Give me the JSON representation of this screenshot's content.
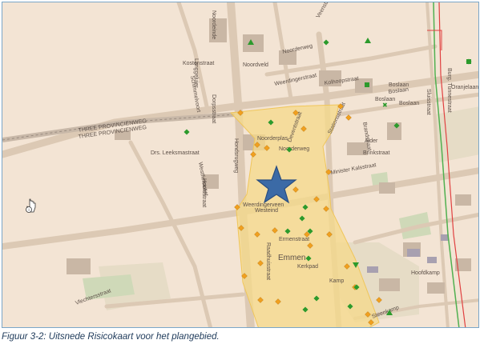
{
  "caption": "Figuur 3-2: Uitsnede Risicokaart voor het plangebied.",
  "map": {
    "colors": {
      "background": "#f3e4d4",
      "road": "#dcc9b4",
      "building": "#c9b7a5",
      "risk_zone": "#f5d98a",
      "hazard_orange": "#f0a020",
      "hazard_green": "#2c9a2c",
      "marker_star": "#3b6aa6",
      "railway": "#8a8a8a",
      "border_red": "#e04040",
      "border_green": "#50b050"
    },
    "street_labels": [
      "Noordeinde",
      "Langgeluier",
      "Noordveld",
      "Noorderweg",
      "Veenstraat",
      "Weerdingerstraat",
      "Kolhoopstraat",
      "Boslaan",
      "Boslaan",
      "Hondsrugweg",
      "Noorderplas",
      "Deventstraat",
      "Stationsstraat",
      "Minister Kalsstraat",
      "Weerdingerveen",
      "Westeind",
      "Kerkpad",
      "Raadhuisstraat",
      "Hoofdstraat",
      "Ermenstraat",
      "Vlechtersstraat",
      "Schimmelvoort",
      "Dorpsstraat",
      "Kamp",
      "Emmen",
      "Brandstraat",
      "Brinkstraat",
      "Drs. Leeksmastraat",
      "Burg. Tunnestraat",
      "Oranjelaan",
      "Steenkamp",
      "Sluisstraat",
      "Westfiefstraat",
      "Kostenstraat",
      "Alder",
      "Hoofdkamp",
      "Boslaan",
      "Noorderweg",
      "THREE PROVINCIENWEG",
      "THREE PROVINCIENWEG",
      "Boslaan"
    ],
    "markers": {
      "star_icon": "star-icon",
      "orange_diamond_icon": "hazard-orange-icon",
      "green_circle_icon": "hazard-green-icon",
      "green_triangle_icon": "hazard-triangle-icon",
      "info_cursor_icon": "info-cursor-icon"
    }
  }
}
